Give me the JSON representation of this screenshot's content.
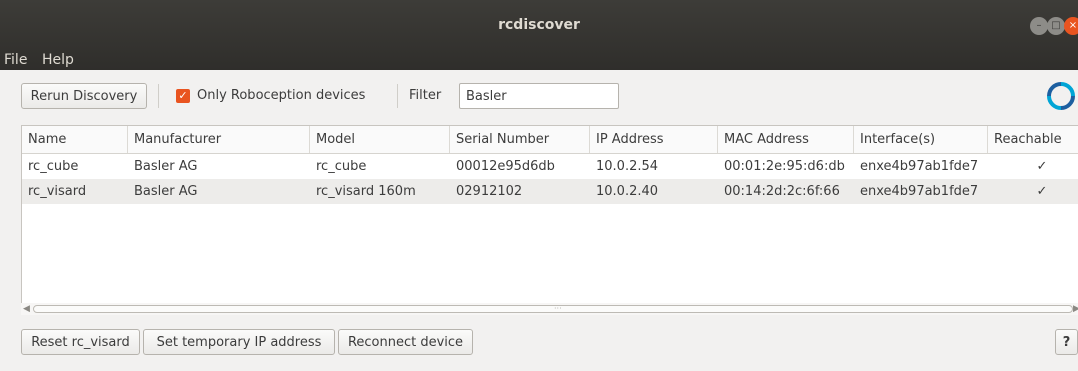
{
  "window": {
    "title": "rcdiscover",
    "controls": {
      "minimize": "–",
      "maximize": "□",
      "close": "×"
    }
  },
  "menu": [
    "File",
    "Help"
  ],
  "toolbar": {
    "rerun_label": "Rerun Discovery",
    "only_roboception_label": "Only Roboception devices",
    "only_roboception_checked": true,
    "filter_label": "Filter",
    "filter_value": "Basler"
  },
  "table": {
    "columns": [
      "Name",
      "Manufacturer",
      "Model",
      "Serial Number",
      "IP Address",
      "MAC Address",
      "Interface(s)",
      "Reachable"
    ],
    "rows": [
      [
        "rc_cube",
        "Basler AG",
        "rc_cube",
        "00012e95d6db",
        "10.0.2.54",
        "00:01:2e:95:d6:db",
        "enxe4b97ab1fde7",
        "✓"
      ],
      [
        "rc_visard",
        "Basler AG",
        "rc_visard 160m",
        "02912102",
        "10.0.2.40",
        "00:14:2d:2c:6f:66",
        "enxe4b97ab1fde7",
        "✓"
      ]
    ]
  },
  "bottom": {
    "reset_label": "Reset rc_visard",
    "set_ip_label": "Set temporary IP address",
    "reconnect_label": "Reconnect device",
    "help_label": "?"
  },
  "colors": {
    "accent": "#e95420",
    "logo": "#00a5d6"
  }
}
